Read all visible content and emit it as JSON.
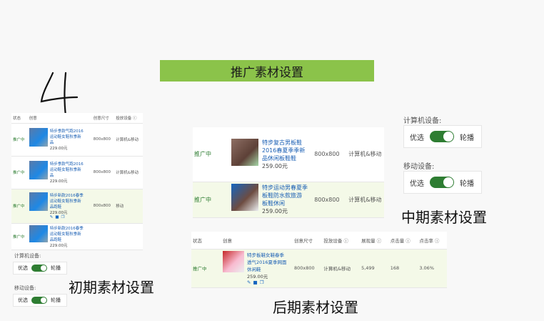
{
  "title": "推广素材设置",
  "handwritten": "4",
  "captions": {
    "early": "初期素材设置",
    "middle": "中期素材设置",
    "late": "后期素材设置"
  },
  "early": {
    "headers": [
      "状态",
      "创意",
      "创意尺寸",
      "投放设备"
    ],
    "rows": [
      {
        "status": "推广中",
        "name": "特步季款气跑2016运动鞋女鞋秋季新品",
        "price": "229.00元",
        "size": "800x800",
        "device": "计算机&移动",
        "highlight": false
      },
      {
        "status": "推广中",
        "name": "特步季款气跑2016运动鞋女鞋秋季新品",
        "price": "229.00元",
        "size": "800x800",
        "device": "计算机&移动",
        "highlight": false
      },
      {
        "status": "推广中",
        "name": "特步新款2016春季运动鞋女鞋秋季新品跑鞋",
        "price": "229.00元",
        "size": "800x800",
        "device": "移动",
        "highlight": true
      },
      {
        "status": "推广中",
        "name": "特步新款2016春季运动鞋女鞋秋季新品跑鞋",
        "price": "229.00元",
        "size": "",
        "device": "",
        "highlight": false
      }
    ],
    "computer_label": "计算机设备:",
    "mobile_label": "移动设备:",
    "opt_left": "优选",
    "opt_right": "轮播"
  },
  "middle": {
    "rows": [
      {
        "status": "推广中",
        "name": "特步复古男板鞋2016春夏季季新品休闲板鞋鞋",
        "price": "259.00元",
        "size": "800x800",
        "device": "计算机&移动",
        "highlight": false
      },
      {
        "status": "推广中",
        "name": "特步运动男春夏季板鞋防水款旅游 板鞋休闲",
        "price": "259.00元",
        "size": "800x800",
        "device": "计算机&移动",
        "highlight": true
      }
    ],
    "computer_label": "计算机设备:",
    "mobile_label": "移动设备:",
    "opt_left": "优选",
    "opt_right": "轮播"
  },
  "late": {
    "headers": [
      "状态",
      "创意",
      "创意尺寸",
      "投放设备",
      "展现量",
      "点击量",
      "点击率"
    ],
    "row": {
      "status": "推广中",
      "name": "特步板鞋女鞋春季透气2016夏季网面休闲鞋",
      "price": "259.00元",
      "size": "800x800",
      "device": "计算机&移动",
      "impressions": "5,499",
      "clicks": "168",
      "ctr": "3.06%"
    }
  }
}
